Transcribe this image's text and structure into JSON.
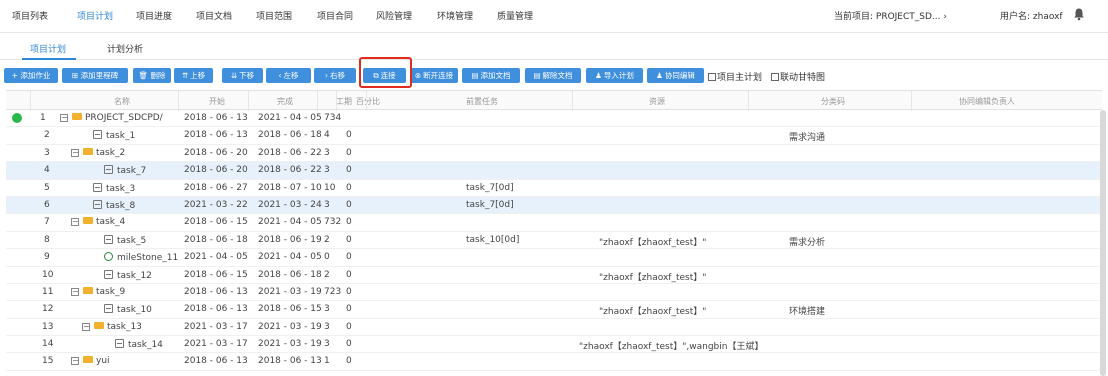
{
  "nav": {
    "items": [
      "项目列表",
      "项目计划",
      "项目进度",
      "项目文档",
      "项目范围",
      "项目合同",
      "风险管理",
      "环境管理",
      "质量管理"
    ],
    "current_project": "当前项目: PROJECT_SD... ›",
    "username": "用户名: zhaoxf"
  },
  "subtabs": [
    "项目计划",
    "计划分析"
  ],
  "toolbar": {
    "buttons": [
      "+ 添加作业",
      "⊞ 添加里程碑",
      "🗑 删除",
      "上移",
      "下移",
      "左移",
      "右移",
      "连接",
      "断开连接",
      "添加文档",
      "解除文档",
      "导入计划",
      "协同编辑"
    ],
    "checkbox_master": "项目主计划",
    "checkbox_gantt": "联动甘特图"
  },
  "table": {
    "headers": [
      "名称",
      "开始",
      "完成",
      "工期",
      "百分比",
      "前置任务",
      "资源",
      "分类码",
      "协同编辑负责人"
    ],
    "rows": [
      {
        "num": "1",
        "name": "PROJECT_SDCPD/",
        "start": "2018 - 06 - 13",
        "end": "2021 - 04 - 05",
        "dur": "734",
        "pct": "",
        "pred": "",
        "res": "",
        "code": ""
      },
      {
        "num": "2",
        "name": "task_1",
        "start": "2018 - 06 - 13",
        "end": "2018 - 06 - 18",
        "dur": "4",
        "pct": "0",
        "pred": "",
        "res": "",
        "code": "需求沟通"
      },
      {
        "num": "3",
        "name": "task_2",
        "start": "2018 - 06 - 20",
        "end": "2018 - 06 - 22",
        "dur": "3",
        "pct": "0",
        "pred": "",
        "res": "",
        "code": ""
      },
      {
        "num": "4",
        "name": "task_7",
        "start": "2018 - 06 - 20",
        "end": "2018 - 06 - 22",
        "dur": "3",
        "pct": "0",
        "pred": "",
        "res": "",
        "code": ""
      },
      {
        "num": "5",
        "name": "task_3",
        "start": "2018 - 06 - 27",
        "end": "2018 - 07 - 10",
        "dur": "10",
        "pct": "0",
        "pred": "task_7[0d]",
        "res": "",
        "code": ""
      },
      {
        "num": "6",
        "name": "task_8",
        "start": "2021 - 03 - 22",
        "end": "2021 - 03 - 24",
        "dur": "3",
        "pct": "0",
        "pred": "task_7[0d]",
        "res": "",
        "code": ""
      },
      {
        "num": "7",
        "name": "task_4",
        "start": "2018 - 06 - 15",
        "end": "2021 - 04 - 05",
        "dur": "732",
        "pct": "0",
        "pred": "",
        "res": "",
        "code": ""
      },
      {
        "num": "8",
        "name": "task_5",
        "start": "2018 - 06 - 18",
        "end": "2018 - 06 - 19",
        "dur": "2",
        "pct": "0",
        "pred": "task_10[0d]",
        "res": "\"zhaoxf【zhaoxf_test】\"",
        "code": "需求分析"
      },
      {
        "num": "9",
        "name": "mileStone_11",
        "start": "2021 - 04 - 05",
        "end": "2021 - 04 - 05",
        "dur": "0",
        "pct": "0",
        "pred": "",
        "res": "",
        "code": ""
      },
      {
        "num": "10",
        "name": "task_12",
        "start": "2018 - 06 - 15",
        "end": "2018 - 06 - 18",
        "dur": "2",
        "pct": "0",
        "pred": "",
        "res": "\"zhaoxf【zhaoxf_test】\"",
        "code": ""
      },
      {
        "num": "11",
        "name": "task_9",
        "start": "2018 - 06 - 13",
        "end": "2021 - 03 - 19",
        "dur": "723",
        "pct": "0",
        "pred": "",
        "res": "",
        "code": ""
      },
      {
        "num": "12",
        "name": "task_10",
        "start": "2018 - 06 - 13",
        "end": "2018 - 06 - 15",
        "dur": "3",
        "pct": "0",
        "pred": "",
        "res": "\"zhaoxf【zhaoxf_test】\"",
        "code": "环境搭建"
      },
      {
        "num": "13",
        "name": "task_13",
        "start": "2021 - 03 - 17",
        "end": "2021 - 03 - 19",
        "dur": "3",
        "pct": "0",
        "pred": "",
        "res": "",
        "code": ""
      },
      {
        "num": "14",
        "name": "task_14",
        "start": "2021 - 03 - 17",
        "end": "2021 - 03 - 19",
        "dur": "3",
        "pct": "0",
        "pred": "",
        "res": "\"zhaoxf【zhaoxf_test】\",wangbin【王斌】",
        "code": ""
      },
      {
        "num": "15",
        "name": "yui",
        "start": "2018 - 06 - 13",
        "end": "2018 - 06 - 13",
        "dur": "1",
        "pct": "0",
        "pred": "",
        "res": "",
        "code": ""
      }
    ]
  },
  "colors": {
    "accent": "#2f86d6",
    "button": "#3f8fdc",
    "highlight": "#e22a1f",
    "selected_row": "#e6f1fb",
    "status_dot": "#2bb84a"
  }
}
